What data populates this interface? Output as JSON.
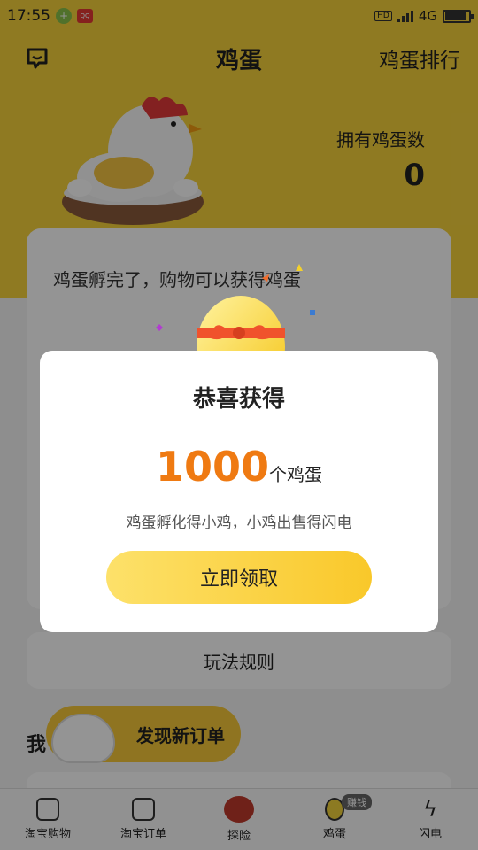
{
  "status_bar": {
    "time": "17:55",
    "network": "4G",
    "hd": "HD"
  },
  "header": {
    "title": "鸡蛋",
    "ranking_link": "鸡蛋排行"
  },
  "eggs": {
    "owned_label": "拥有鸡蛋数",
    "owned_count": "0"
  },
  "card": {
    "message": "鸡蛋孵完了，购物可以获得鸡蛋"
  },
  "rules_button": "玩法规则",
  "my_section": {
    "label": "我",
    "new_order_label": "发现新订单"
  },
  "tabbar": {
    "items": [
      {
        "label": "淘宝购物",
        "icon": "shopping-bag-icon"
      },
      {
        "label": "淘宝订单",
        "icon": "order-icon"
      },
      {
        "label": "探险",
        "icon": "adventure-icon"
      },
      {
        "label": "鸡蛋",
        "icon": "egg-icon",
        "badge": "赚钱"
      },
      {
        "label": "闪电",
        "icon": "lightning-icon"
      }
    ]
  },
  "modal": {
    "title": "恭喜获得",
    "reward_amount": "1000",
    "reward_unit": "个鸡蛋",
    "description": "鸡蛋孵化得小鸡，小鸡出售得闪电",
    "claim_button": "立即领取"
  },
  "colors": {
    "brand_yellow": "#f6d23c",
    "reward_orange": "#ef7a12",
    "button_gradient_start": "#fde16a",
    "button_gradient_end": "#f9c82a"
  }
}
